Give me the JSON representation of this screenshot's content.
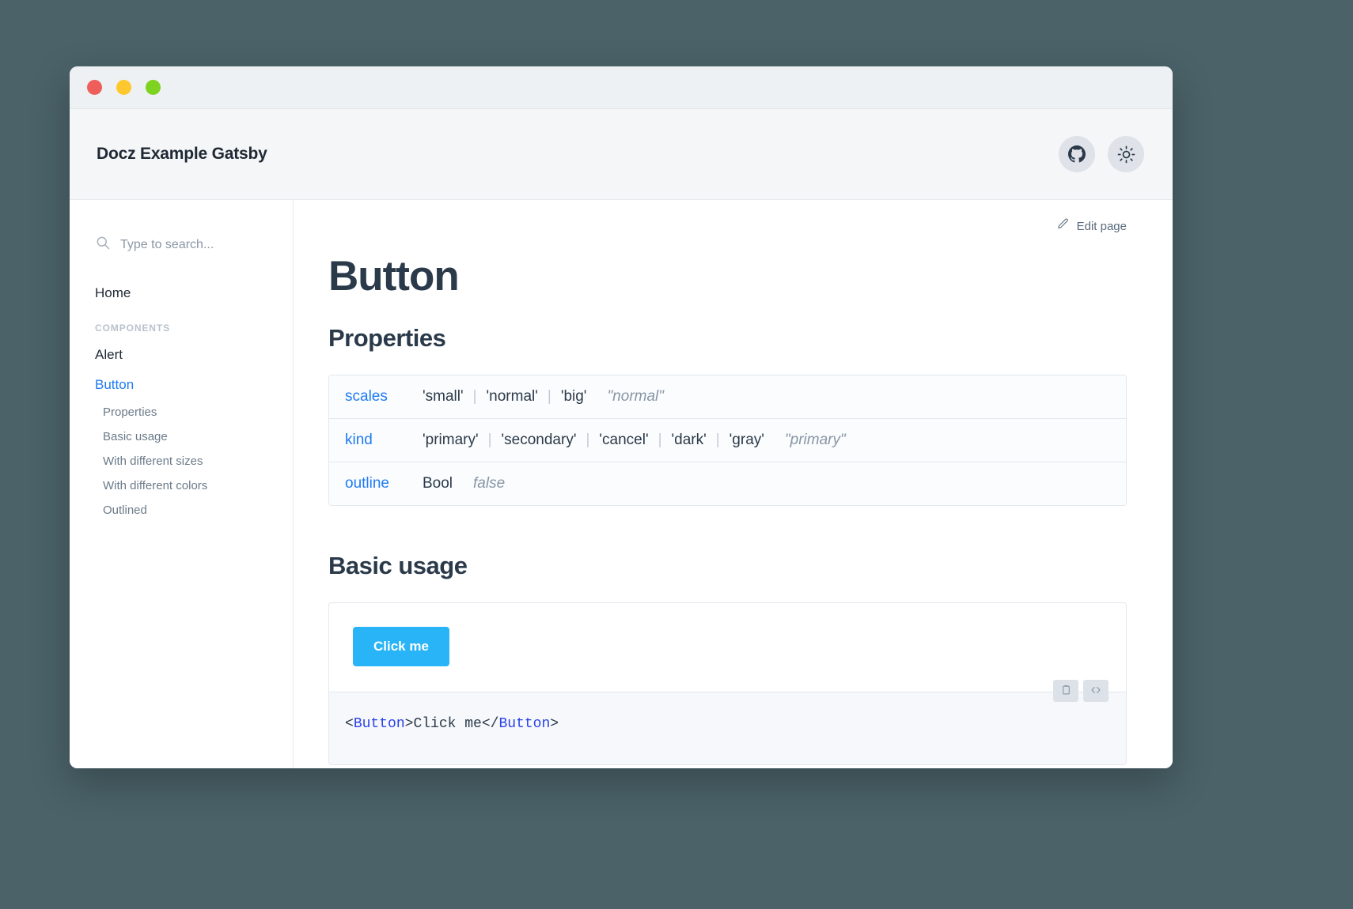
{
  "window": {
    "traffic_lights": [
      {
        "name": "close",
        "color": "#ee5f5b"
      },
      {
        "name": "minimize",
        "color": "#fdc82e"
      },
      {
        "name": "maximize",
        "color": "#7ed321"
      }
    ]
  },
  "header": {
    "brand": "Docz Example Gatsby",
    "actions": [
      {
        "icon": "github-icon",
        "label": "GitHub"
      },
      {
        "icon": "sun-icon",
        "label": "Toggle color mode"
      }
    ]
  },
  "sidebar": {
    "search": {
      "placeholder": "Type to search...",
      "value": "",
      "icon": "search-icon"
    },
    "home_label": "Home",
    "group_title": "COMPONENTS",
    "items": [
      {
        "label": "Alert",
        "active": false
      },
      {
        "label": "Button",
        "active": true
      }
    ],
    "sub_items": [
      {
        "label": "Properties"
      },
      {
        "label": "Basic usage"
      },
      {
        "label": "With different sizes"
      },
      {
        "label": "With different colors"
      },
      {
        "label": "Outlined"
      }
    ]
  },
  "main": {
    "edit_page_label": "Edit page",
    "edit_page_icon": "pencil-icon",
    "page_title": "Button",
    "properties_heading": "Properties",
    "properties": [
      {
        "name": "scales",
        "type_values": [
          "'small'",
          "'normal'",
          "'big'"
        ],
        "default": "\"normal\""
      },
      {
        "name": "kind",
        "type_values": [
          "'primary'",
          "'secondary'",
          "'cancel'",
          "'dark'",
          "'gray'"
        ],
        "default": "\"primary\""
      },
      {
        "name": "outline",
        "type_values": [
          "Bool"
        ],
        "default": "false"
      }
    ],
    "basic_usage_heading": "Basic usage",
    "demo_button_label": "Click me",
    "code": {
      "open_tag_left": "<",
      "tag_name": "Button",
      "open_tag_right": ">",
      "content": "Click me",
      "close_tag_left": "</",
      "close_tag_right": ">",
      "toolbar": [
        {
          "icon": "clipboard-icon",
          "label": "Copy"
        },
        {
          "icon": "code-icon",
          "label": "Show code"
        }
      ]
    }
  },
  "colors": {
    "page_background": "#4a6268",
    "accent_blue": "#1e7bf4",
    "demo_button": "#29b4f7",
    "heading": "#2b3a4a"
  }
}
